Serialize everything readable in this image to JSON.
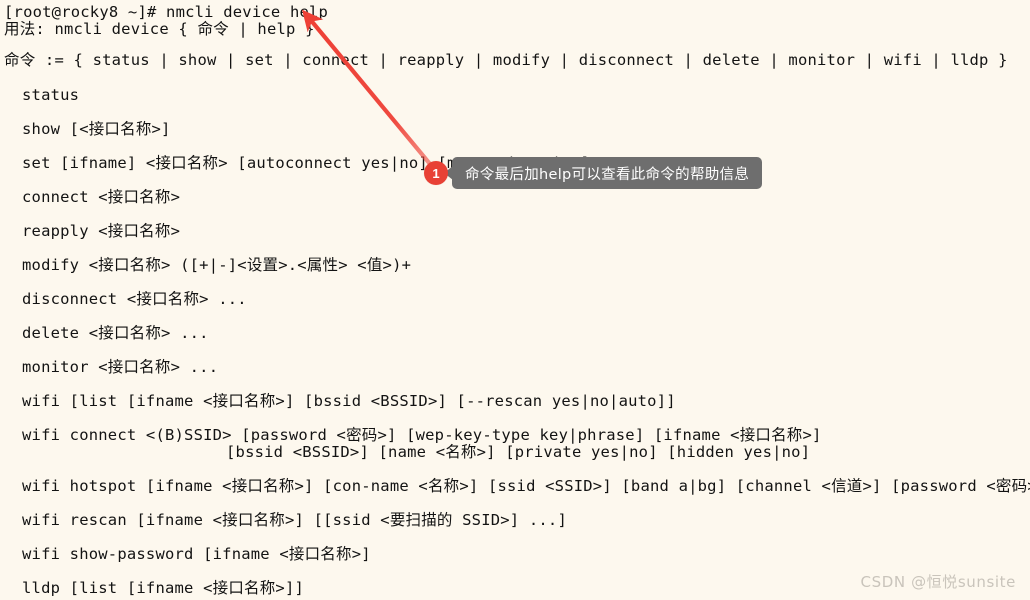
{
  "terminal": {
    "prompt_line": "[root@rocky8 ~]# nmcli device help",
    "usage_line": "用法: nmcli device { 命令 | help }",
    "commands_header": "命令 := { status | show | set | connect | reapply | modify | disconnect | delete | monitor | wifi | lldp }",
    "commands": [
      "status",
      "show [<接口名称>]",
      "set [ifname] <接口名称> [autoconnect yes|no] [managed yes|no]",
      "connect <接口名称>",
      "reapply <接口名称>",
      "modify <接口名称> ([+|-]<设置>.<属性> <值>)+",
      "disconnect <接口名称> ...",
      "delete <接口名称> ...",
      "monitor <接口名称> ...",
      "wifi [list [ifname <接口名称>] [bssid <BSSID>] [--rescan yes|no|auto]]",
      "wifi connect <(B)SSID> [password <密码>] [wep-key-type key|phrase] [ifname <接口名称>]",
      "[bssid <BSSID>] [name <名称>] [private yes|no] [hidden yes|no]",
      "wifi hotspot [ifname <接口名称>] [con-name <名称>] [ssid <SSID>] [band a|bg] [channel <信道>] [password <密码>]",
      "wifi rescan [ifname <接口名称>] [[ssid <要扫描的 SSID>] ...]",
      "wifi show-password [ifname <接口名称>]",
      "lldp [list [ifname <接口名称>]]"
    ],
    "text_color": "#131313",
    "background_color": "#fdf8ee"
  },
  "annotation": {
    "badge_number": "1",
    "badge_color": "#e84135",
    "tooltip_text": "命令最后加help可以查看此命令的帮助信息",
    "tooltip_color": "#6e6e6e",
    "arrow_color": "#ee4036"
  },
  "watermark": {
    "text": "CSDN @恒悦sunsite",
    "color": "#c9c4bb"
  }
}
